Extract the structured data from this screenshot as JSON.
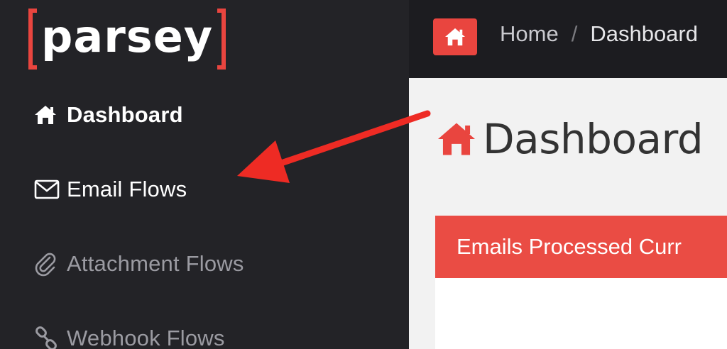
{
  "logo": {
    "text": "parsey"
  },
  "sidebar": {
    "items": [
      {
        "label": "Dashboard",
        "icon": "home-icon"
      },
      {
        "label": "Email Flows",
        "icon": "envelope-icon"
      },
      {
        "label": "Attachment Flows",
        "icon": "paperclip-icon"
      },
      {
        "label": "Webhook Flows",
        "icon": "link-icon"
      }
    ]
  },
  "topbar": {
    "breadcrumb": {
      "home": "Home",
      "separator": "/",
      "current": "Dashboard"
    }
  },
  "main": {
    "title": "Dashboard",
    "panel_title": "Emails Processed Curr"
  },
  "colors": {
    "accent": "#e9453f",
    "sidebar": "#232327",
    "content": "#f2f2f2"
  }
}
